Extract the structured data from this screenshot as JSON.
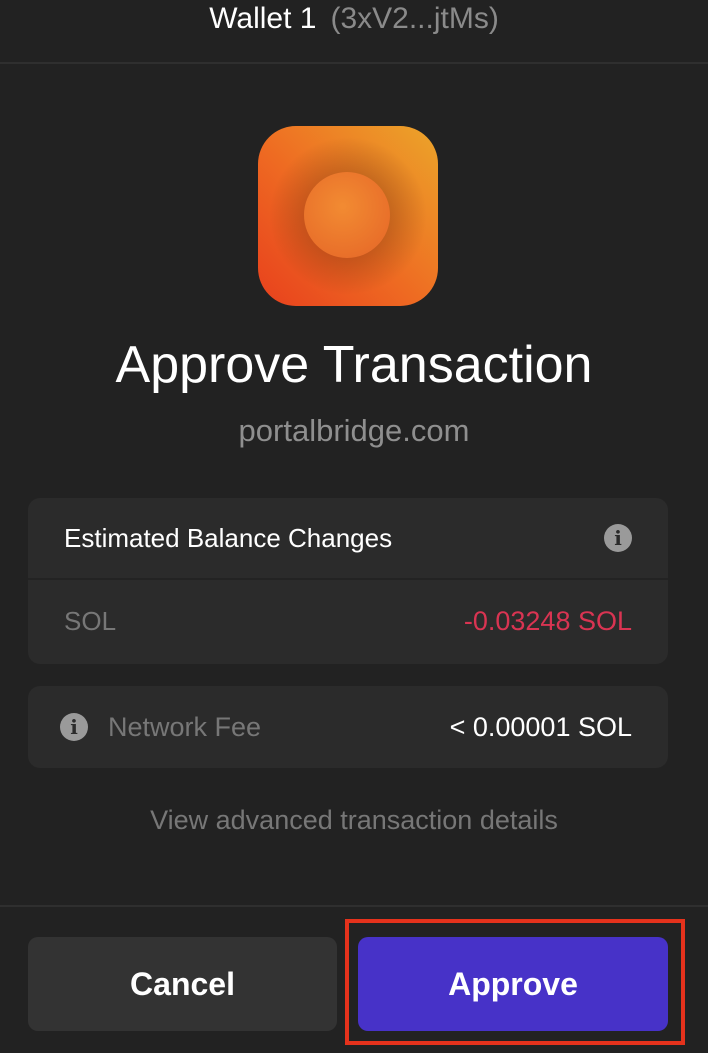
{
  "header": {
    "wallet_name": "Wallet 1",
    "wallet_address": "(3xV2...jtMs)"
  },
  "app": {
    "icon": "dapp-orange-icon",
    "title": "Approve Transaction",
    "origin": "portalbridge.com"
  },
  "balance_changes": {
    "label": "Estimated Balance Changes",
    "info_icon": "info-icon",
    "rows": [
      {
        "token": "SOL",
        "change": "-0.03248 SOL"
      }
    ]
  },
  "network_fee": {
    "label": "Network Fee",
    "value": "< 0.00001 SOL"
  },
  "advanced_link": "View advanced transaction details",
  "actions": {
    "cancel_label": "Cancel",
    "approve_label": "Approve"
  },
  "colors": {
    "background": "#222222",
    "card": "#2b2b2b",
    "accent": "#4732c8",
    "negative": "#d93452",
    "highlight": "#e5321c"
  }
}
